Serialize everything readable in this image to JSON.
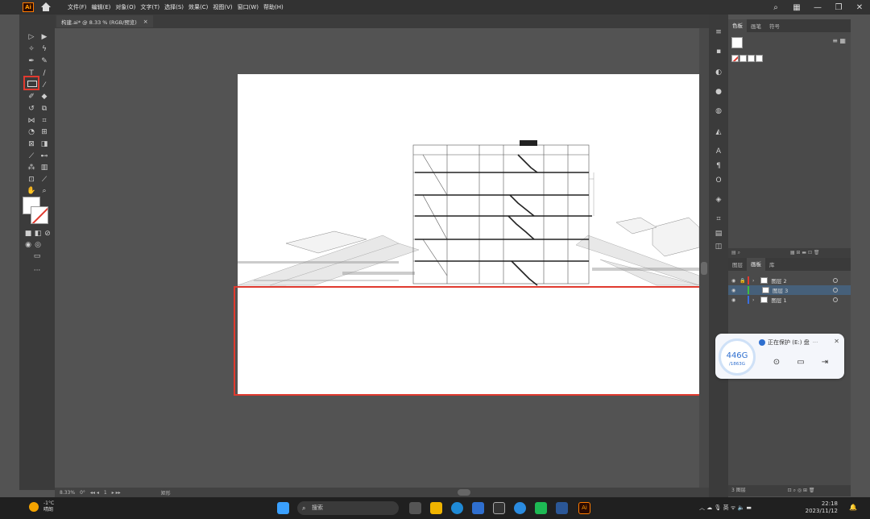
{
  "app": {
    "logo": "Ai"
  },
  "menu": {
    "items": [
      "文件(F)",
      "编辑(E)",
      "对象(O)",
      "文字(T)",
      "选择(S)",
      "效果(C)",
      "视图(V)",
      "窗口(W)",
      "帮助(H)"
    ]
  },
  "window_controls": {
    "minimize": "—",
    "restore": "❐",
    "close": "✕"
  },
  "document": {
    "tab_label": "构建.ai* @ 8.33 % (RGB/预览)",
    "close": "×"
  },
  "status": {
    "zoom": "8.33%",
    "rotation": "0°",
    "page": "1",
    "tool": "矩形"
  },
  "swatches_panel": {
    "tabs": [
      "色板",
      "画笔",
      "符号"
    ],
    "active_tab": "色板"
  },
  "layers_panel": {
    "tabs": [
      "图层",
      "画板",
      "库"
    ],
    "active_tab": "图层",
    "layers": [
      {
        "name": "图层 2",
        "color": "#e03a2f",
        "locked": true,
        "selected": false
      },
      {
        "name": "图层 3",
        "color": "#3fbf3f",
        "locked": false,
        "selected": true
      },
      {
        "name": "图层 1",
        "color": "#3a6fe0",
        "locked": false,
        "selected": false
      }
    ],
    "footer": "3 图层"
  },
  "widget": {
    "title": "正在保护 (E:) 盘",
    "used": "446G",
    "total": "/1863G"
  },
  "taskbar": {
    "weather_temp": "-1°C",
    "weather_desc": "晴朗",
    "search_placeholder": "搜索",
    "ime": "英",
    "time": "22:18",
    "date": "2023/11/12"
  },
  "colors": {
    "accent": "#e03a2f",
    "panel": "#4a4a4a",
    "canvas": "#535353"
  }
}
